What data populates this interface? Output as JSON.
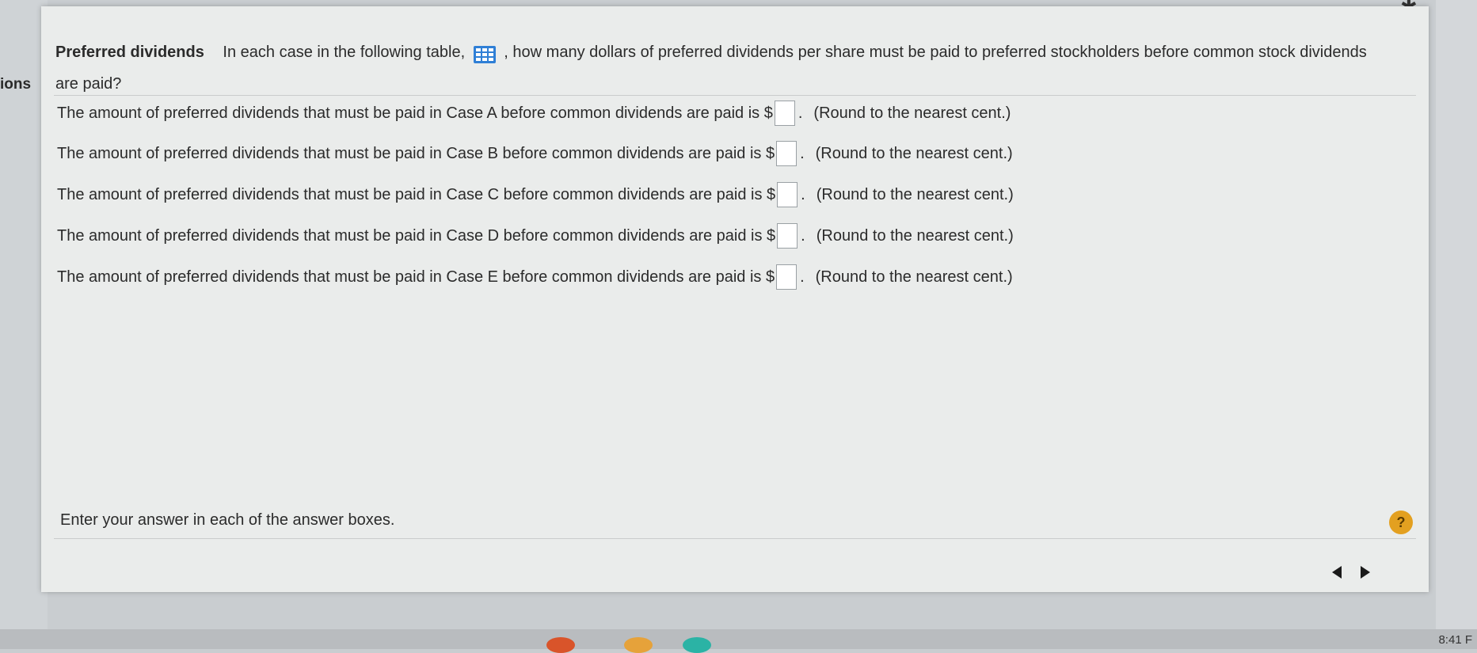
{
  "sidebar": {
    "label": "ions"
  },
  "question": {
    "topic": "Preferred dividends",
    "text_before_icon": "In each case in the following table,",
    "text_after_icon": ", how many dollars of preferred dividends per share must be paid to preferred stockholders before common stock dividends are paid?"
  },
  "answers": [
    {
      "prefix": "The amount of preferred dividends that must be paid in Case A before common dividends are paid is $",
      "value": "",
      "suffix": ".",
      "hint": "(Round to the nearest cent.)"
    },
    {
      "prefix": "The amount of preferred dividends that must be paid in Case B before common dividends are paid is $",
      "value": "",
      "suffix": ".",
      "hint": "(Round to the nearest cent.)"
    },
    {
      "prefix": "The amount of preferred dividends that must be paid in Case C before common dividends are paid is $",
      "value": "",
      "suffix": ".",
      "hint": "(Round to the nearest cent.)"
    },
    {
      "prefix": "The amount of preferred dividends that must be paid in Case D before common dividends are paid is $",
      "value": "",
      "suffix": ".",
      "hint": "(Round to the nearest cent.)"
    },
    {
      "prefix": "The amount of preferred dividends that must be paid in Case E before common dividends are paid is $",
      "value": "",
      "suffix": ".",
      "hint": "(Round to the nearest cent.)"
    }
  ],
  "footer": {
    "instruction": "Enter your answer in each of the answer boxes.",
    "help_label": "?"
  },
  "taskbar": {
    "clock": "8:41 F"
  },
  "colors": {
    "panel_bg": "#eaeceb",
    "help_btn": "#e3a020",
    "table_icon": "#2f7fd6"
  }
}
